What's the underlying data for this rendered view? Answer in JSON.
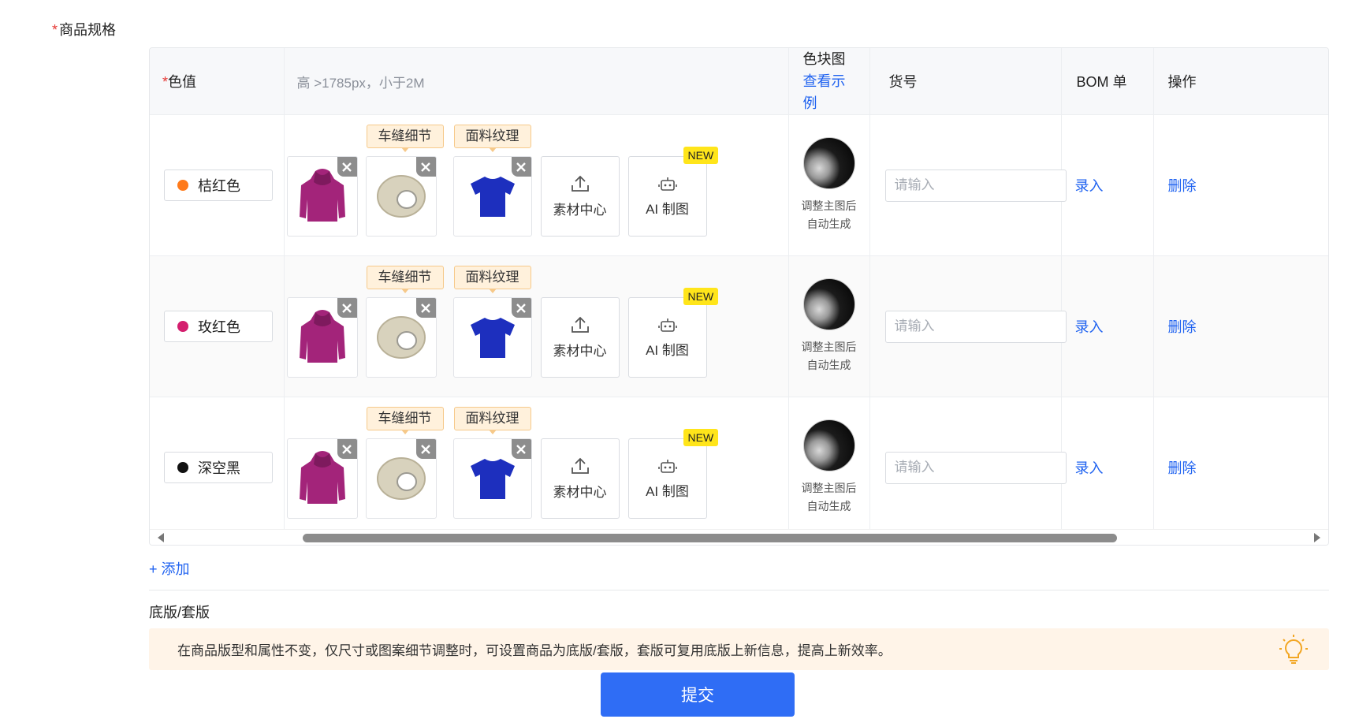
{
  "section": {
    "title": "商品规格",
    "required_mark": "*"
  },
  "headers": {
    "color": "色值",
    "image": "高 >1785px，小于2M",
    "swatch_line1": "色块图",
    "swatch_link": "查看示例",
    "sku": "货号",
    "bom": "BOM 单",
    "ops": "操作"
  },
  "rows": [
    {
      "color_name": "桔红色",
      "dot_color": "#ff7a1a",
      "tag1": "车缝细节",
      "tag2": "面料纹理",
      "material": "素材中心",
      "ai": "AI 制图",
      "new_badge": "NEW",
      "swatch_line1": "调整主图后",
      "swatch_line2": "自动生成",
      "sku_placeholder": "请输入",
      "bom_action": "录入",
      "delete_action": "删除"
    },
    {
      "color_name": "玫红色",
      "dot_color": "#d41e6e",
      "tag1": "车缝细节",
      "tag2": "面料纹理",
      "material": "素材中心",
      "ai": "AI 制图",
      "new_badge": "NEW",
      "swatch_line1": "调整主图后",
      "swatch_line2": "自动生成",
      "sku_placeholder": "请输入",
      "bom_action": "录入",
      "delete_action": "删除"
    },
    {
      "color_name": "深空黑",
      "dot_color": "#111111",
      "tag1": "车缝细节",
      "tag2": "面料纹理",
      "material": "素材中心",
      "ai": "AI 制图",
      "new_badge": "NEW",
      "swatch_line1": "调整主图后",
      "swatch_line2": "自动生成",
      "sku_placeholder": "请输入",
      "bom_action": "录入",
      "delete_action": "删除"
    }
  ],
  "add_label": "+ 添加",
  "base_section": {
    "title": "底版/套版",
    "tip": "在商品版型和属性不变，仅尺寸或图案细节调整时，可设置商品为底版/套版，套版可复用底版上新信息，提高上新效率。"
  },
  "submit_label": "提交",
  "icons": {
    "product_images": [
      "hoodie-icon",
      "tape-roll-icon",
      "tshirt-icon"
    ],
    "upload": "upload-icon",
    "robot": "robot-icon",
    "close": "close-icon",
    "bulb": "lightbulb-icon"
  },
  "colors": {
    "link": "#1f62f0",
    "primary": "#2f6df5",
    "tag_bg": "#fff1dc",
    "new_badge": "#ffe51a",
    "tip_bg": "#fff4e8",
    "required": "#e53935"
  }
}
